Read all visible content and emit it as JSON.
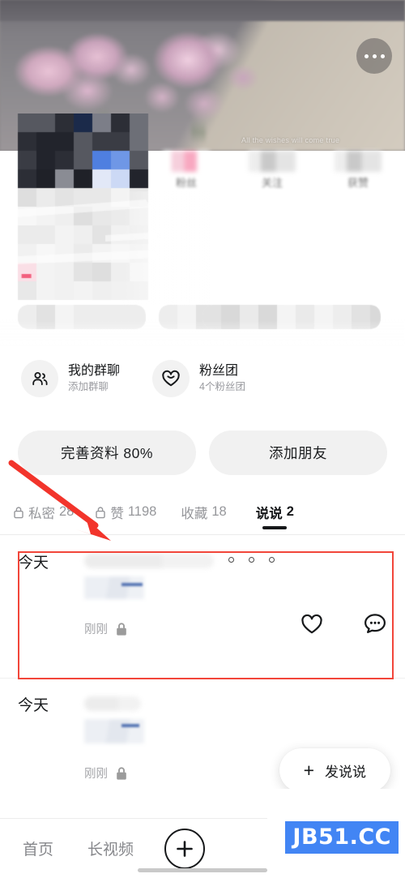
{
  "cover": {
    "caption": "All the wishes will come true",
    "more_icon": "more-horizontal-icon"
  },
  "profile": {
    "censored": true,
    "stats": [
      {
        "label": "粉丝",
        "value": "",
        "censored": true
      },
      {
        "label": "关注",
        "value": "",
        "censored": true
      },
      {
        "label": "获赞",
        "value": "",
        "censored": true
      }
    ]
  },
  "shortcuts": [
    {
      "icon": "group-people-icon",
      "title": "我的群聊",
      "subtitle": "添加群聊"
    },
    {
      "icon": "heart-fanclub-icon",
      "title": "粉丝团",
      "subtitle": "4个粉丝团"
    }
  ],
  "actions": {
    "complete_profile": "完善资料 80%",
    "add_friend": "添加朋友"
  },
  "tabs": [
    {
      "label": "私密",
      "count": "28",
      "locked": true,
      "active": false
    },
    {
      "label": "赞",
      "count": "1198",
      "locked": true,
      "active": false
    },
    {
      "label": "收藏",
      "count": "18",
      "locked": false,
      "active": false
    },
    {
      "label": "说说",
      "count": "2",
      "locked": false,
      "active": true
    }
  ],
  "feed": [
    {
      "date": "今天",
      "time": "刚刚",
      "private_icon": "lock-filled-icon",
      "like_icon": "heart-icon",
      "comment_icon": "comment-bubble-icon",
      "highlighted": true
    },
    {
      "date": "今天",
      "time": "刚刚",
      "private_icon": "lock-filled-icon",
      "like_icon": "heart-icon",
      "comment_icon": "comment-bubble-icon",
      "highlighted": false
    }
  ],
  "fab": {
    "plus": "+",
    "label": "发说说"
  },
  "bottom_nav": {
    "items": [
      {
        "label": "首页"
      },
      {
        "label": "长视频"
      }
    ],
    "plus_icon": "plus-icon"
  },
  "watermark": {
    "text": "JB51.CC"
  },
  "colors": {
    "accent_red": "#f2463a",
    "watermark_blue": "#4285f4",
    "text_primary": "#16181a",
    "text_muted": "#96979b",
    "chip_bg": "#f1f1f1"
  }
}
